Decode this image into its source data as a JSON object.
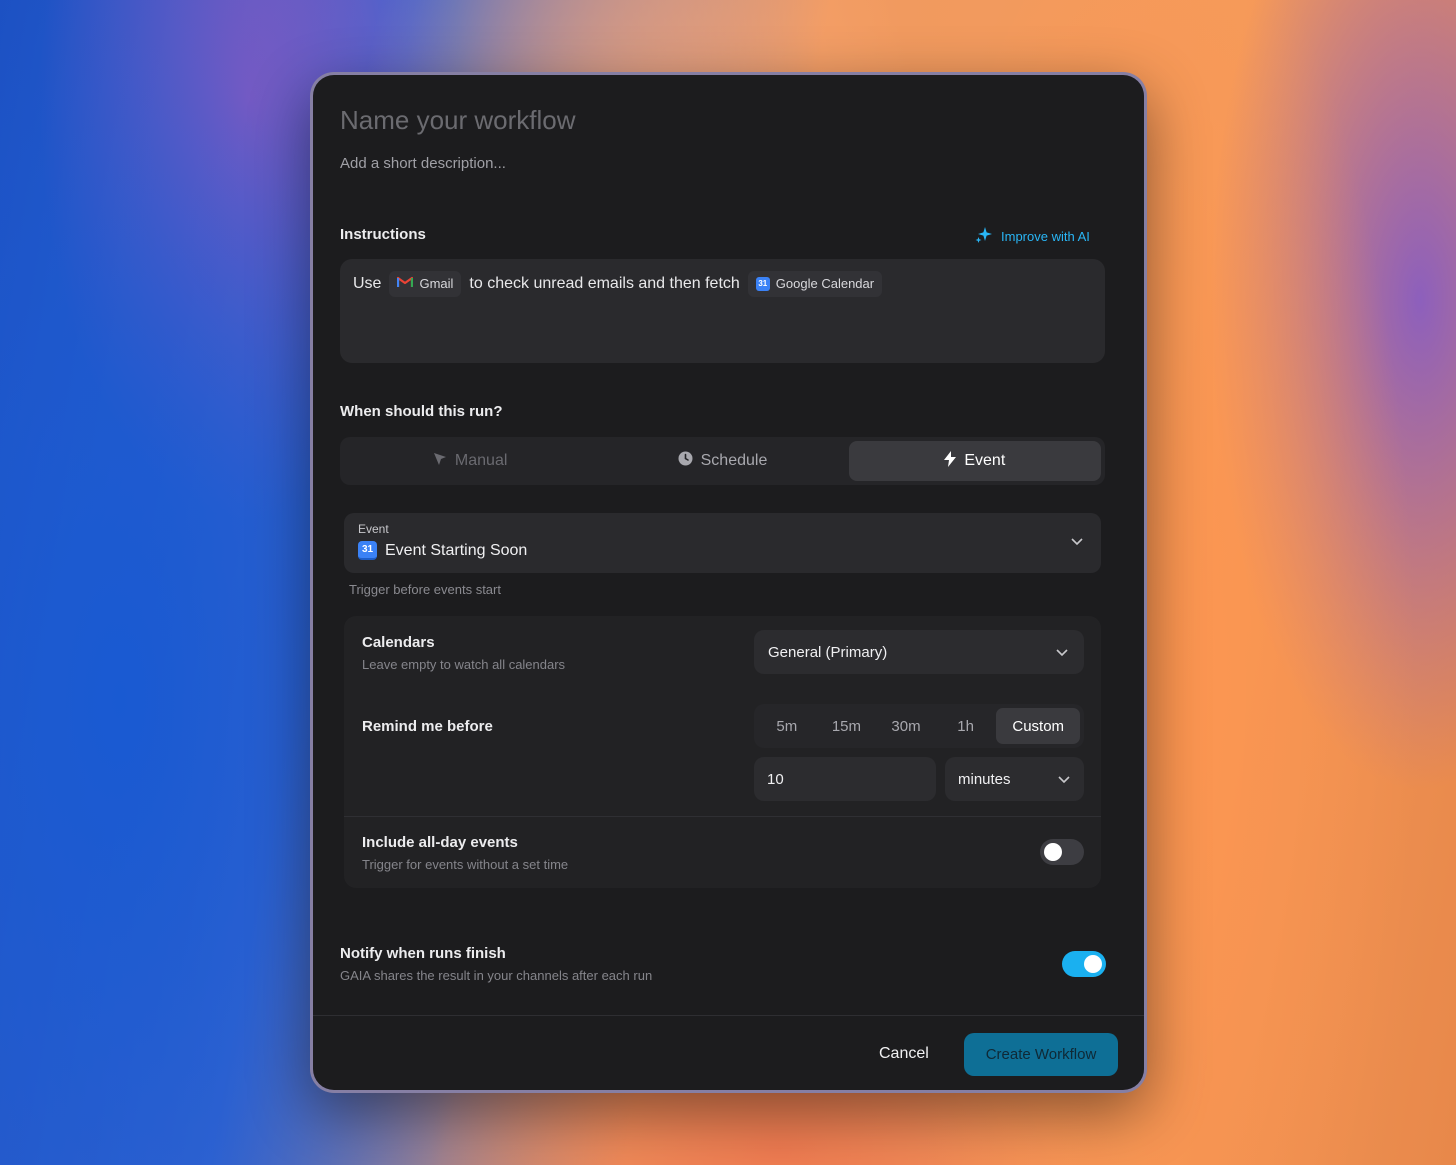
{
  "workflow": {
    "name_placeholder": "Name your workflow",
    "description_placeholder": "Add a short description..."
  },
  "instructions": {
    "label": "Instructions",
    "improve_label": "Improve with AI",
    "text_use": "Use",
    "gmail_chip": "Gmail",
    "text_middle": "to check unread emails and then fetch",
    "gcal_chip": "Google Calendar",
    "gcal_badge": "31"
  },
  "trigger": {
    "label": "When should this run?",
    "tabs": [
      {
        "label": "Manual",
        "icon": "cursor-icon",
        "state": "disabled"
      },
      {
        "label": "Schedule",
        "icon": "clock-icon",
        "state": "normal"
      },
      {
        "label": "Event",
        "icon": "lightning-icon",
        "state": "active"
      }
    ]
  },
  "event": {
    "small_label": "Event",
    "value": "Event Starting Soon",
    "badge": "31",
    "hint": "Trigger before events start"
  },
  "calendars": {
    "title": "Calendars",
    "subtitle": "Leave empty to watch all calendars",
    "selected": "General (Primary)"
  },
  "remind": {
    "title": "Remind me before",
    "options": [
      "5m",
      "15m",
      "30m",
      "1h",
      "Custom"
    ],
    "active": "Custom",
    "value": "10",
    "unit": "minutes"
  },
  "all_day": {
    "title": "Include all-day events",
    "subtitle": "Trigger for events without a set time",
    "enabled": false
  },
  "notify": {
    "title": "Notify when runs finish",
    "subtitle": "GAIA shares the result in your channels after each run",
    "enabled": true
  },
  "footer": {
    "cancel_label": "Cancel",
    "create_label": "Create Workflow"
  },
  "colors": {
    "accent": "#1ab0f0",
    "improve": "#29b6f6",
    "create_button": "#0e6f96",
    "panel": "#1c1c1e"
  }
}
